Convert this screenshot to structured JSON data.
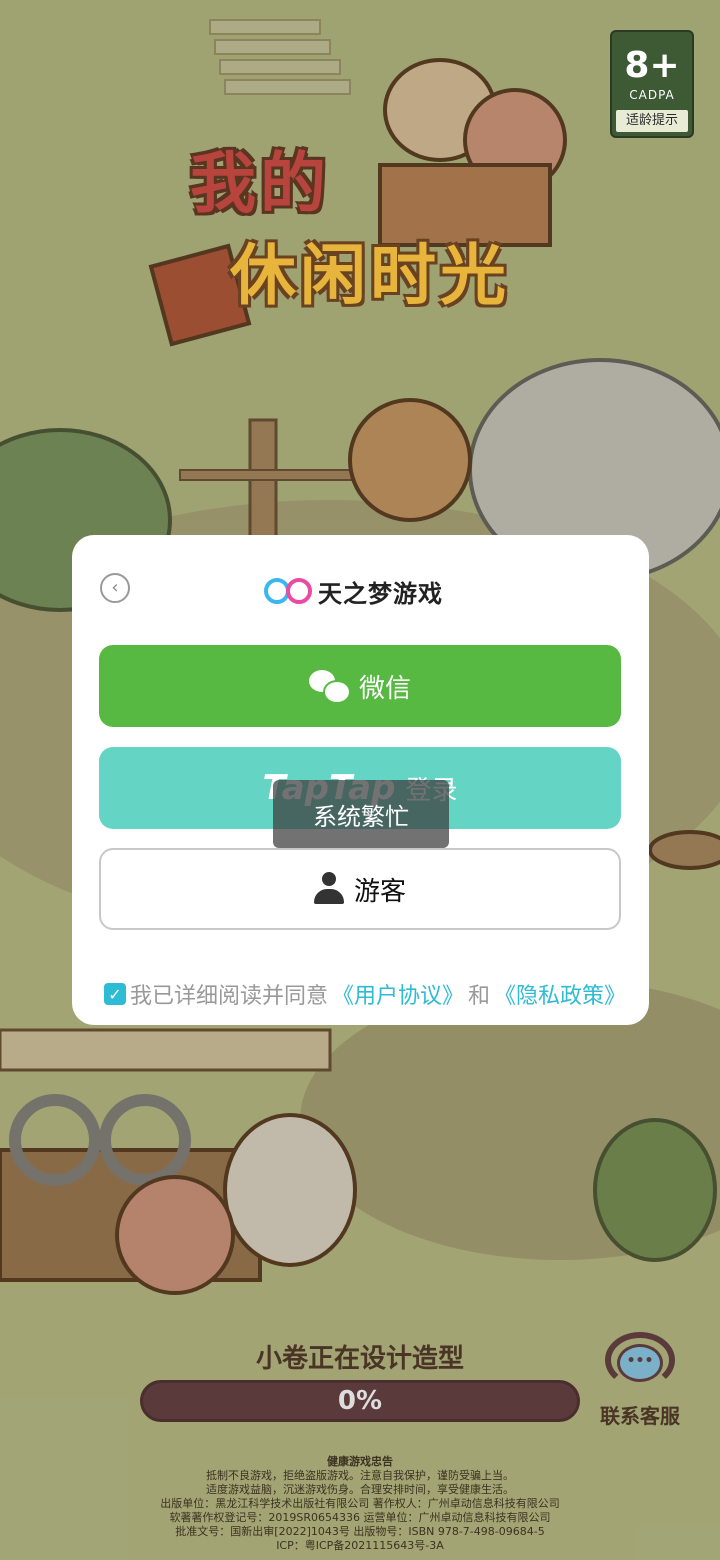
{
  "age_rating": {
    "number": "8+",
    "org": "CADPA",
    "label": "适龄提示"
  },
  "logo": {
    "line1": "我的",
    "line2": "休闲时光"
  },
  "dialog": {
    "back_icon": "chevron-left-icon",
    "brand_name": "天之梦游戏",
    "wechat_button": "微信",
    "taptap_button_logo": "TapTap",
    "taptap_button_text": "登录",
    "toast": "系统繁忙",
    "guest_button": "游客",
    "agreement": {
      "checked": true,
      "text": "我已详细阅读并同意",
      "link_user": "《用户协议》",
      "and": "和",
      "link_privacy": "《隐私政策》"
    }
  },
  "loading": {
    "title": "小卷正在设计造型",
    "progress_label": "0%",
    "progress": 0
  },
  "customer_service": {
    "label": "联系客服"
  },
  "footer": {
    "head": "健康游戏忠告",
    "lines": [
      "抵制不良游戏，拒绝盗版游戏。注意自我保护，谨防受骗上当。",
      "适度游戏益脑，沉迷游戏伤身。合理安排时间，享受健康生活。",
      "出版单位：黑龙江科学技术出版社有限公司  著作权人：广州卓动信息科技有限公司",
      "软著著作权登记号：2019SR0654336  运营单位：广州卓动信息科技有限公司",
      "批准文号：国新出审[2022]1043号  出版物号：ISBN 978-7-498-09684-5",
      "ICP：粤ICP备2021115643号-3A"
    ]
  },
  "colors": {
    "wechat_green": "#57b942",
    "taptap_teal": "#64d4c4",
    "link_blue": "#2ebbd4",
    "progress_bar": "#5a3a3a"
  }
}
